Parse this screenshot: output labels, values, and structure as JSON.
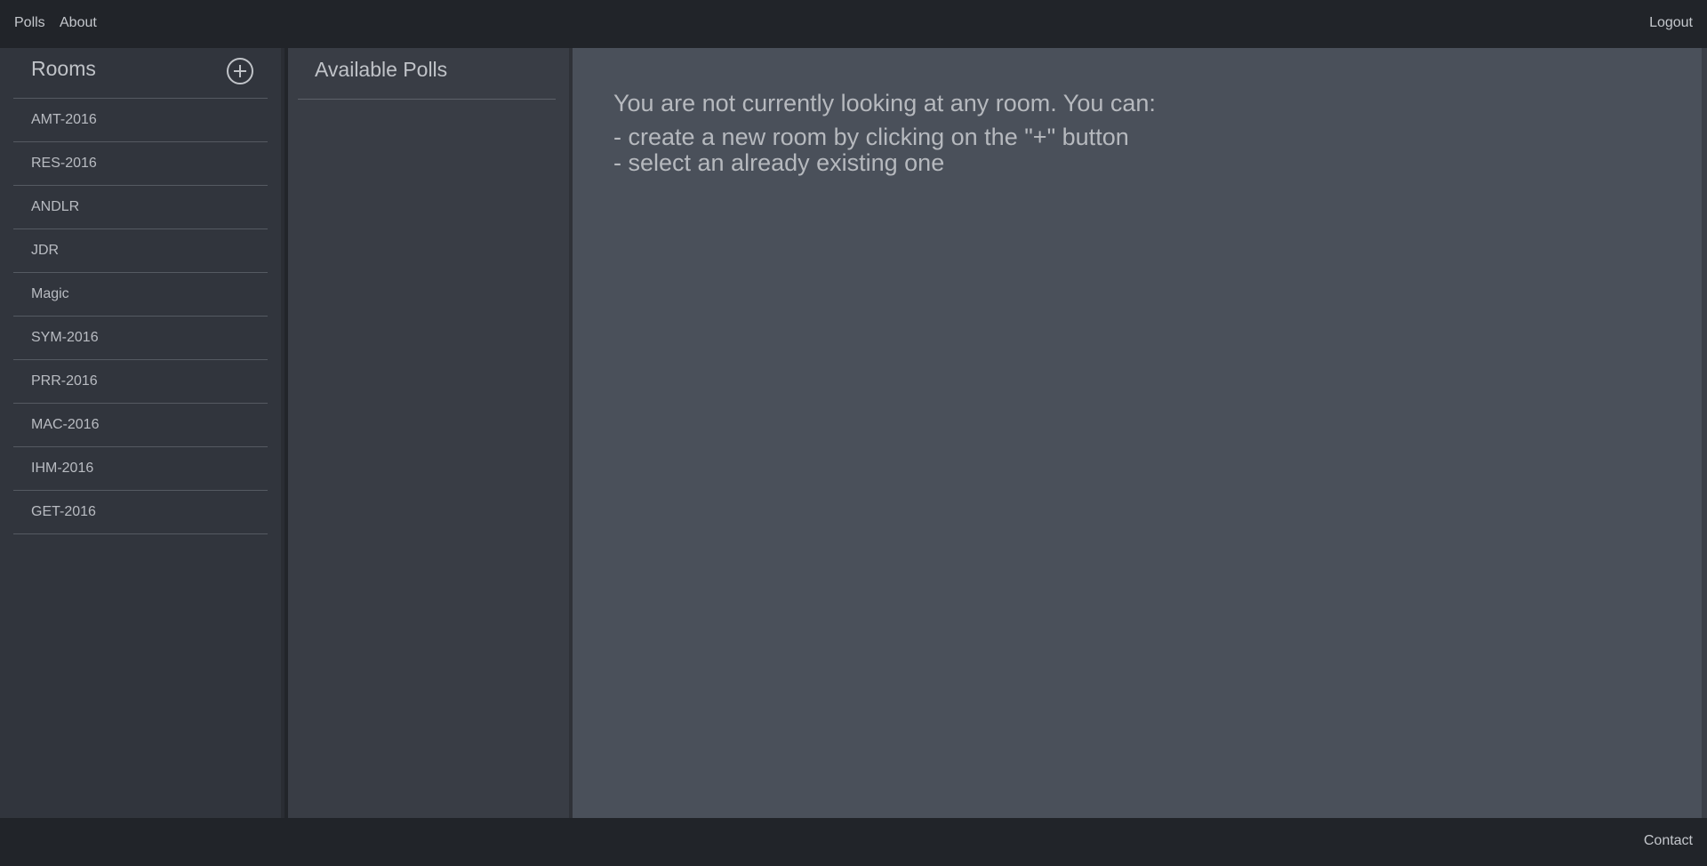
{
  "nav": {
    "polls": "Polls",
    "about": "About",
    "logout": "Logout"
  },
  "rooms": {
    "title": "Rooms",
    "add_icon": "plus-circle-icon",
    "items": [
      {
        "label": "AMT-2016"
      },
      {
        "label": "RES-2016"
      },
      {
        "label": "ANDLR"
      },
      {
        "label": "JDR"
      },
      {
        "label": "Magic"
      },
      {
        "label": "SYM-2016"
      },
      {
        "label": "PRR-2016"
      },
      {
        "label": "MAC-2016"
      },
      {
        "label": "IHM-2016"
      },
      {
        "label": "GET-2016"
      }
    ]
  },
  "polls": {
    "title": "Available Polls"
  },
  "main": {
    "line1": "You are not currently looking at any room. You can:",
    "line2": "- create a new room by clicking on the \"+\" button",
    "line3": "- select an already existing one"
  },
  "footer": {
    "contact": "Contact"
  },
  "colors": {
    "topbar": "#212429",
    "rooms_bg": "#31353d",
    "polls_bg": "#393d45",
    "main_bg": "#4a505a",
    "text": "#b9bcc2"
  }
}
